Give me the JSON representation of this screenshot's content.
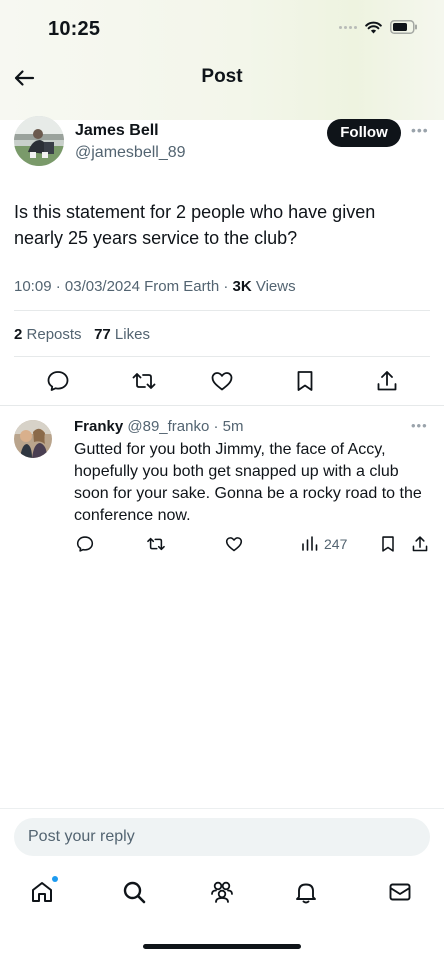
{
  "status_bar": {
    "time": "10:25"
  },
  "nav": {
    "title": "Post"
  },
  "post": {
    "author_name": "James Bell",
    "author_handle": "@jamesbell_89",
    "follow_label": "Follow",
    "text": "Is this statement for 2 people who have given nearly 25 years service to the club?",
    "time": "10:09",
    "date": "03/03/2024",
    "source": "From Earth",
    "views_count": "3K",
    "views_label": "Views",
    "reposts_count": "2",
    "reposts_label": "Reposts",
    "likes_count": "77",
    "likes_label": "Likes"
  },
  "reply": {
    "name": "Franky",
    "handle": "@89_franko",
    "age": "5m",
    "text": "Gutted for you both Jimmy, the face of Accy, hopefully you both get snapped up with a club soon for your sake. Gonna be a rocky road to the conference now.",
    "views": "247"
  },
  "composer": {
    "placeholder": "Post your reply"
  },
  "icons": {
    "back": "back-arrow-icon",
    "more": "more-icon",
    "reply": "reply-icon",
    "repost": "repost-icon",
    "like": "heart-icon",
    "bookmark": "bookmark-icon",
    "share": "share-icon",
    "views": "bar-chart-icon",
    "tabs": [
      "home-icon",
      "search-icon",
      "communities-icon",
      "notifications-icon",
      "messages-icon"
    ]
  },
  "colors": {
    "text": "#0f1419",
    "secondary": "#536471",
    "accent": "#1d9bf0",
    "divider": "#e6e9ea"
  }
}
